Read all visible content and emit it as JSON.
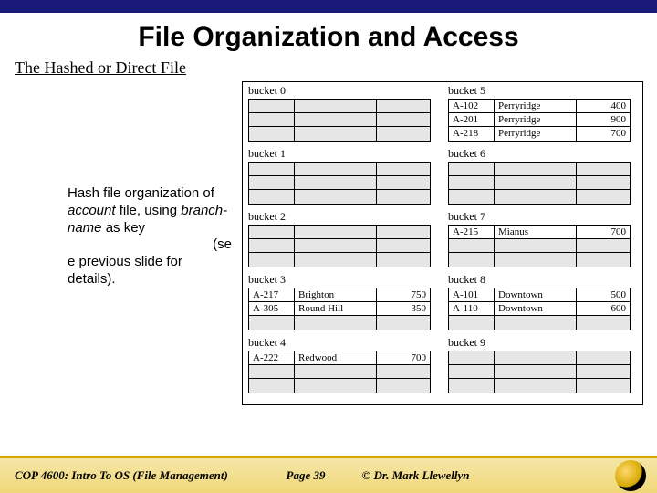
{
  "title": "File Organization and Access",
  "subtitle": "The Hashed or Direct File",
  "caption": {
    "line1": "Hash file organization of ",
    "italic1": "account",
    "line2": " file, using ",
    "italic2": "branch-name",
    "line3": " as key",
    "line4": "(se",
    "line5": "e previous slide for details)."
  },
  "footer": {
    "left": "COP 4600: Intro To OS  (File Management)",
    "center": "Page 39",
    "right": "© Dr. Mark Llewellyn"
  },
  "buckets_left": [
    {
      "label": "bucket 0",
      "rows": [
        [
          "",
          "",
          ""
        ],
        [
          "",
          "",
          ""
        ],
        [
          "",
          "",
          ""
        ]
      ],
      "shaded": true
    },
    {
      "label": "bucket 1",
      "rows": [
        [
          "",
          "",
          ""
        ],
        [
          "",
          "",
          ""
        ],
        [
          "",
          "",
          ""
        ]
      ],
      "shaded": true
    },
    {
      "label": "bucket 2",
      "rows": [
        [
          "",
          "",
          ""
        ],
        [
          "",
          "",
          ""
        ],
        [
          "",
          "",
          ""
        ]
      ],
      "shaded": true
    },
    {
      "label": "bucket 3",
      "rows": [
        [
          "A-217",
          "Brighton",
          "750"
        ],
        [
          "A-305",
          "Round Hill",
          "350"
        ],
        [
          "",
          "",
          ""
        ]
      ],
      "shaded": false
    },
    {
      "label": "bucket 4",
      "rows": [
        [
          "A-222",
          "Redwood",
          "700"
        ],
        [
          "",
          "",
          ""
        ],
        [
          "",
          "",
          ""
        ]
      ],
      "shaded": false
    }
  ],
  "buckets_right": [
    {
      "label": "bucket 5",
      "rows": [
        [
          "A-102",
          "Perryridge",
          "400"
        ],
        [
          "A-201",
          "Perryridge",
          "900"
        ],
        [
          "A-218",
          "Perryridge",
          "700"
        ]
      ],
      "shaded": false
    },
    {
      "label": "bucket 6",
      "rows": [
        [
          "",
          "",
          ""
        ],
        [
          "",
          "",
          ""
        ],
        [
          "",
          "",
          ""
        ]
      ],
      "shaded": true
    },
    {
      "label": "bucket 7",
      "rows": [
        [
          "A-215",
          "Mianus",
          "700"
        ],
        [
          "",
          "",
          ""
        ],
        [
          "",
          "",
          ""
        ]
      ],
      "shaded": false
    },
    {
      "label": "bucket 8",
      "rows": [
        [
          "A-101",
          "Downtown",
          "500"
        ],
        [
          "A-110",
          "Downtown",
          "600"
        ],
        [
          "",
          "",
          ""
        ]
      ],
      "shaded": false
    },
    {
      "label": "bucket 9",
      "rows": [
        [
          "",
          "",
          ""
        ],
        [
          "",
          "",
          ""
        ],
        [
          "",
          "",
          ""
        ]
      ],
      "shaded": true
    }
  ]
}
